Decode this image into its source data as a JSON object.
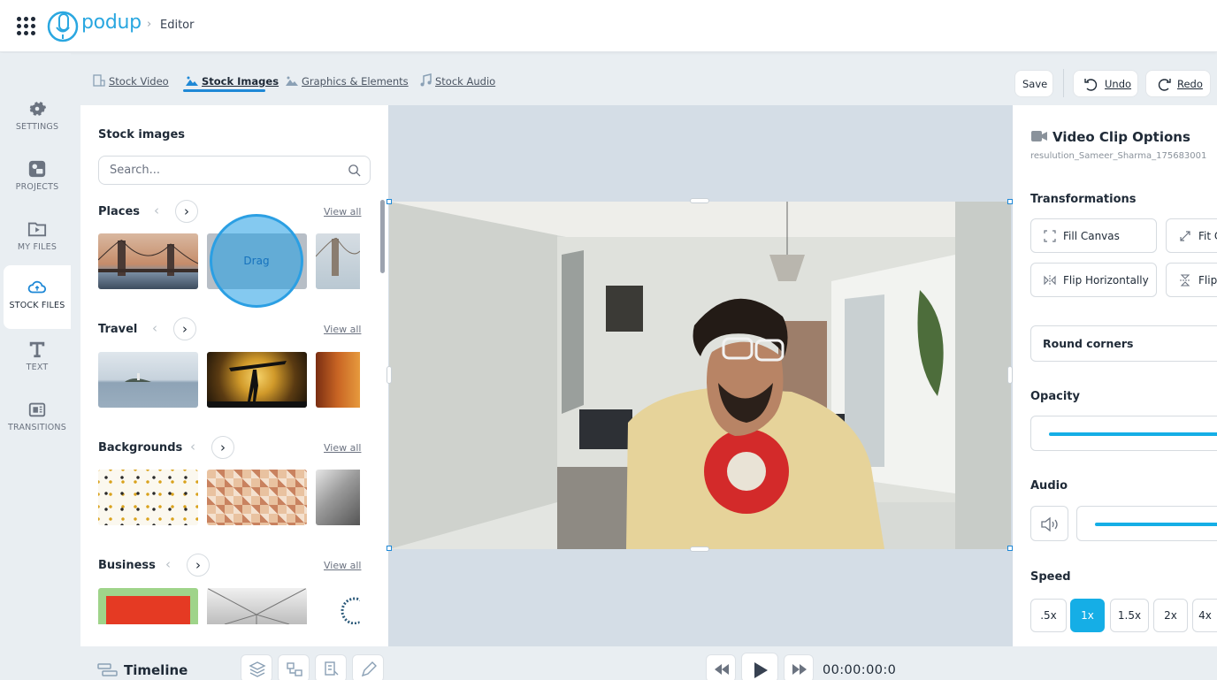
{
  "header": {
    "logo_text": "podup",
    "breadcrumb": "Editor"
  },
  "sidebar": {
    "items": [
      {
        "label": "SETTINGS",
        "icon": "gear-icon"
      },
      {
        "label": "PROJECTS",
        "icon": "projects-icon"
      },
      {
        "label": "MY FILES",
        "icon": "folder-play-icon"
      },
      {
        "label": "STOCK FILES",
        "icon": "cloud-icon",
        "active": true
      },
      {
        "label": "TEXT",
        "icon": "text-t-icon"
      },
      {
        "label": "TRANSITIONS",
        "icon": "transitions-icon"
      }
    ]
  },
  "tabs": [
    {
      "label": "Stock Video"
    },
    {
      "label": "Stock Images",
      "active": true
    },
    {
      "label": "Graphics & Elements"
    },
    {
      "label": "Stock Audio"
    }
  ],
  "toolbar": {
    "save_label": "Save",
    "undo_label": "Undo",
    "redo_label": "Redo"
  },
  "stock_panel": {
    "title": "Stock images",
    "search_placeholder": "Search...",
    "view_all_label": "View all",
    "categories": [
      {
        "name": "Places"
      },
      {
        "name": "Travel"
      },
      {
        "name": "Backgrounds"
      },
      {
        "name": "Business"
      }
    ],
    "drag_label": "Drag"
  },
  "clip_options": {
    "title": "Video Clip Options",
    "filename": "resulution_Sameer_Sharma_175683001",
    "transformations_label": "Transformations",
    "fill_canvas_label": "Fill Canvas",
    "fit_label": "Fit C",
    "flip_h_label": "Flip Horizontally",
    "flip_v_label": "Flip",
    "round_corners_label": "Round corners",
    "opacity_label": "Opacity",
    "audio_label": "Audio",
    "speed_label": "Speed",
    "speeds": [
      ".5x",
      "1x",
      "1.5x",
      "2x",
      "4x"
    ],
    "selected_speed": "1x"
  },
  "timeline": {
    "label": "Timeline",
    "time": "00:00:00:0"
  },
  "colors": {
    "accent": "#15aee6",
    "link_blue": "#1e88d6"
  }
}
